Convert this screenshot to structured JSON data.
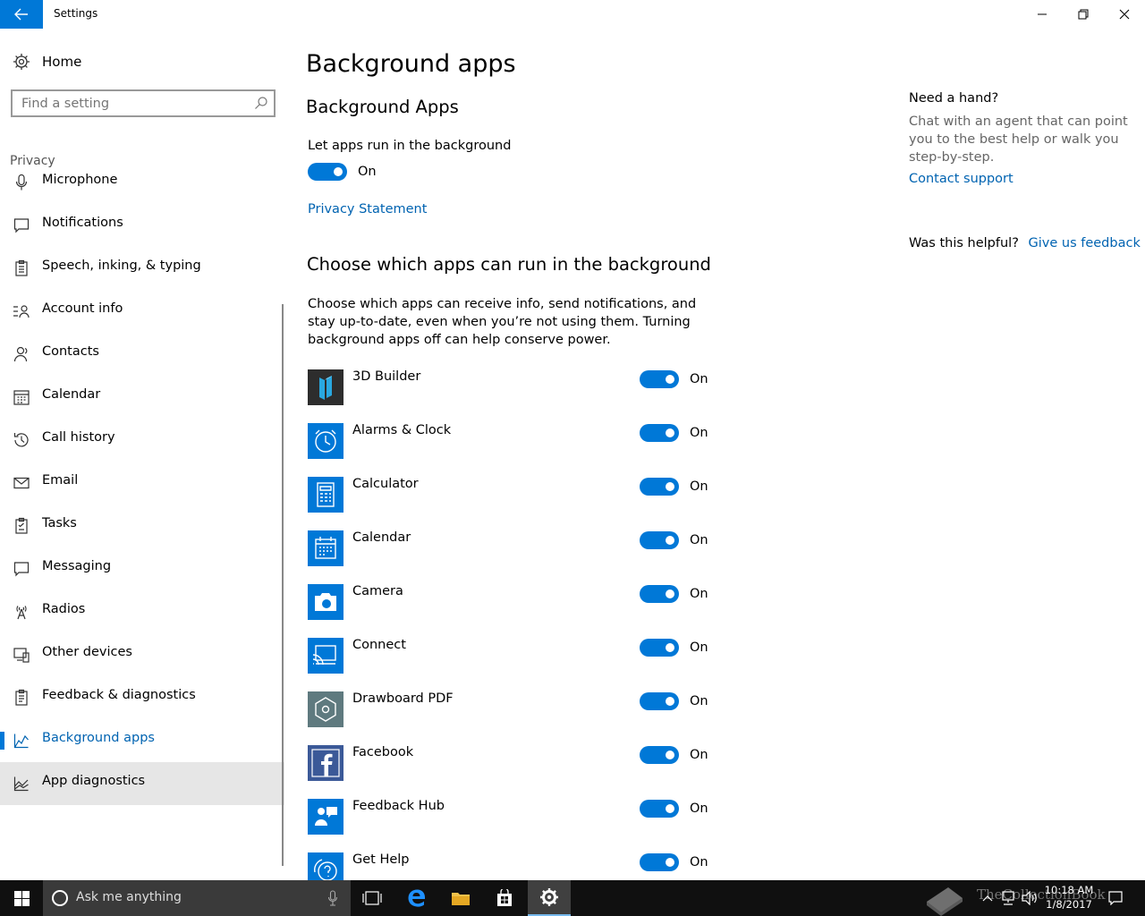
{
  "window": {
    "title": "Settings"
  },
  "colors": {
    "accent": "#0078d7",
    "link": "#0063b1",
    "taskbar": "#101010"
  },
  "sidebar": {
    "home_label": "Home",
    "search_placeholder": "Find a setting",
    "section_label": "Privacy",
    "items": [
      {
        "label": "Microphone",
        "icon": "microphone-icon"
      },
      {
        "label": "Notifications",
        "icon": "notification-icon"
      },
      {
        "label": "Speech, inking, & typing",
        "icon": "clipboard-icon"
      },
      {
        "label": "Account info",
        "icon": "account-info-icon"
      },
      {
        "label": "Contacts",
        "icon": "contacts-icon"
      },
      {
        "label": "Calendar",
        "icon": "calendar-icon"
      },
      {
        "label": "Call history",
        "icon": "history-icon"
      },
      {
        "label": "Email",
        "icon": "mail-icon"
      },
      {
        "label": "Tasks",
        "icon": "tasks-icon"
      },
      {
        "label": "Messaging",
        "icon": "message-icon"
      },
      {
        "label": "Radios",
        "icon": "radio-tower-icon"
      },
      {
        "label": "Other devices",
        "icon": "devices-icon"
      },
      {
        "label": "Feedback & diagnostics",
        "icon": "feedback-icon"
      },
      {
        "label": "Background apps",
        "icon": "background-apps-icon",
        "selected": true
      },
      {
        "label": "App diagnostics",
        "icon": "app-diagnostics-icon",
        "hovered": true
      }
    ]
  },
  "main": {
    "page_title": "Background apps",
    "section1_title": "Background Apps",
    "let_apps_label": "Let apps run in the background",
    "master_toggle_state": "On",
    "privacy_link": "Privacy Statement",
    "section2_title": "Choose which apps can run in the background",
    "section2_desc": "Choose which apps can receive info, send notifications, and stay up-to-date, even when you’re not using them. Turning background apps off can help conserve power.",
    "apps": [
      {
        "name": "3D Builder",
        "state": "On",
        "tile_color": "#2d2d2d",
        "icon": "3d-builder-icon"
      },
      {
        "name": "Alarms & Clock",
        "state": "On",
        "tile_color": "#0078d7",
        "icon": "alarm-clock-icon"
      },
      {
        "name": "Calculator",
        "state": "On",
        "tile_color": "#0078d7",
        "icon": "calculator-icon"
      },
      {
        "name": "Calendar",
        "state": "On",
        "tile_color": "#0078d7",
        "icon": "calendar-app-icon"
      },
      {
        "name": "Camera",
        "state": "On",
        "tile_color": "#0078d7",
        "icon": "camera-icon"
      },
      {
        "name": "Connect",
        "state": "On",
        "tile_color": "#0078d7",
        "icon": "connect-icon"
      },
      {
        "name": "Drawboard PDF",
        "state": "On",
        "tile_color": "#5f7a7f",
        "icon": "drawboard-icon"
      },
      {
        "name": "Facebook",
        "state": "On",
        "tile_color": "#3b5998",
        "icon": "facebook-icon"
      },
      {
        "name": "Feedback Hub",
        "state": "On",
        "tile_color": "#0078d7",
        "icon": "feedback-hub-icon"
      },
      {
        "name": "Get Help",
        "state": "On",
        "tile_color": "#0078d7",
        "icon": "get-help-icon"
      }
    ]
  },
  "help_panel": {
    "heading": "Need a hand?",
    "text": "Chat with an agent that can point you to the best help or walk you step-by-step.",
    "contact_link": "Contact support",
    "helpful_label": "Was this helpful?",
    "feedback_link": "Give us feedback"
  },
  "taskbar": {
    "search_text": "Ask me anything",
    "time": "10:18 AM",
    "date": "1/8/2017",
    "watermark_text": "TheCollectionBook"
  }
}
